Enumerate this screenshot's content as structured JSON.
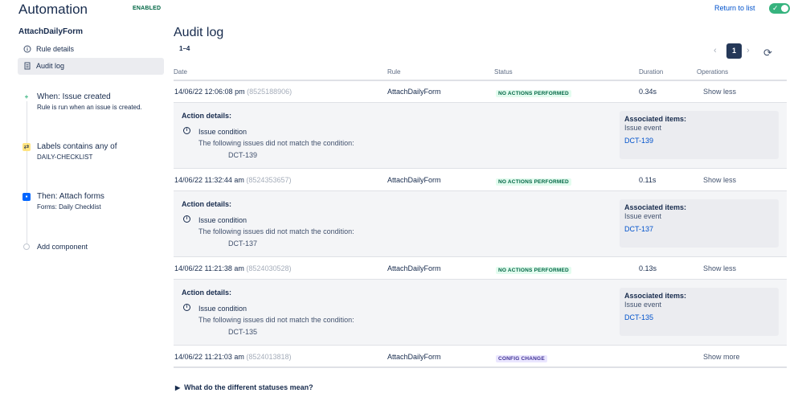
{
  "app": {
    "title": "Automation",
    "status_badge": "ENABLED",
    "return_link": "Return to list",
    "toggle_on": true
  },
  "sidebar": {
    "rule_name": "AttachDailyForm",
    "nav": [
      {
        "label": "Rule details",
        "icon": "info-icon"
      },
      {
        "label": "Audit log",
        "icon": "document-icon"
      }
    ],
    "components": [
      {
        "title": "When: Issue created",
        "subtitle": "Rule is run when an issue is created.",
        "icon": "trigger-icon"
      },
      {
        "title": "Labels contains any of",
        "subtitle": "DAILY-CHECKLIST",
        "icon": "condition-icon"
      },
      {
        "title": "Then: Attach forms",
        "subtitle": "Forms: Daily Checklist",
        "icon": "action-icon"
      },
      {
        "title": "Add component",
        "subtitle": "",
        "icon": "add-icon"
      }
    ]
  },
  "main": {
    "title": "Audit log",
    "range": "1–4",
    "pagination": {
      "current": "1"
    },
    "columns": {
      "date": "Date",
      "rule": "Rule",
      "status": "Status",
      "duration": "Duration",
      "operations": "Operations"
    },
    "rows": [
      {
        "date": "14/06/22 12:06:08 pm",
        "id": "(8525188906)",
        "rule": "AttachDailyForm",
        "status": "NO ACTIONS PERFORMED",
        "status_kind": "none",
        "duration": "0.34s",
        "operation": "Show less",
        "details": {
          "title": "Action details:",
          "condition": "Issue condition",
          "message": "The following issues did not match the condition:",
          "issue": "DCT-139",
          "assoc_title": "Associated items:",
          "assoc_sub": "Issue event",
          "assoc_link": "DCT-139"
        }
      },
      {
        "date": "14/06/22 11:32:44 am",
        "id": "(8524353657)",
        "rule": "AttachDailyForm",
        "status": "NO ACTIONS PERFORMED",
        "status_kind": "none",
        "duration": "0.11s",
        "operation": "Show less",
        "details": {
          "title": "Action details:",
          "condition": "Issue condition",
          "message": "The following issues did not match the condition:",
          "issue": "DCT-137",
          "assoc_title": "Associated items:",
          "assoc_sub": "Issue event",
          "assoc_link": "DCT-137"
        }
      },
      {
        "date": "14/06/22 11:21:38 am",
        "id": "(8524030528)",
        "rule": "AttachDailyForm",
        "status": "NO ACTIONS PERFORMED",
        "status_kind": "none",
        "duration": "0.13s",
        "operation": "Show less",
        "details": {
          "title": "Action details:",
          "condition": "Issue condition",
          "message": "The following issues did not match the condition:",
          "issue": "DCT-135",
          "assoc_title": "Associated items:",
          "assoc_sub": "Issue event",
          "assoc_link": "DCT-135"
        }
      },
      {
        "date": "14/06/22 11:21:03 am",
        "id": "(8524013818)",
        "rule": "AttachDailyForm",
        "status": "CONFIG CHANGE",
        "status_kind": "config",
        "duration": "",
        "operation": "Show more"
      }
    ],
    "faq": "What do the different statuses mean?"
  },
  "colors": {
    "accent": "#0052cc",
    "toggle": "#36b37e",
    "status_none_bg": "#e3fcef",
    "status_config_bg": "#eae6ff"
  }
}
